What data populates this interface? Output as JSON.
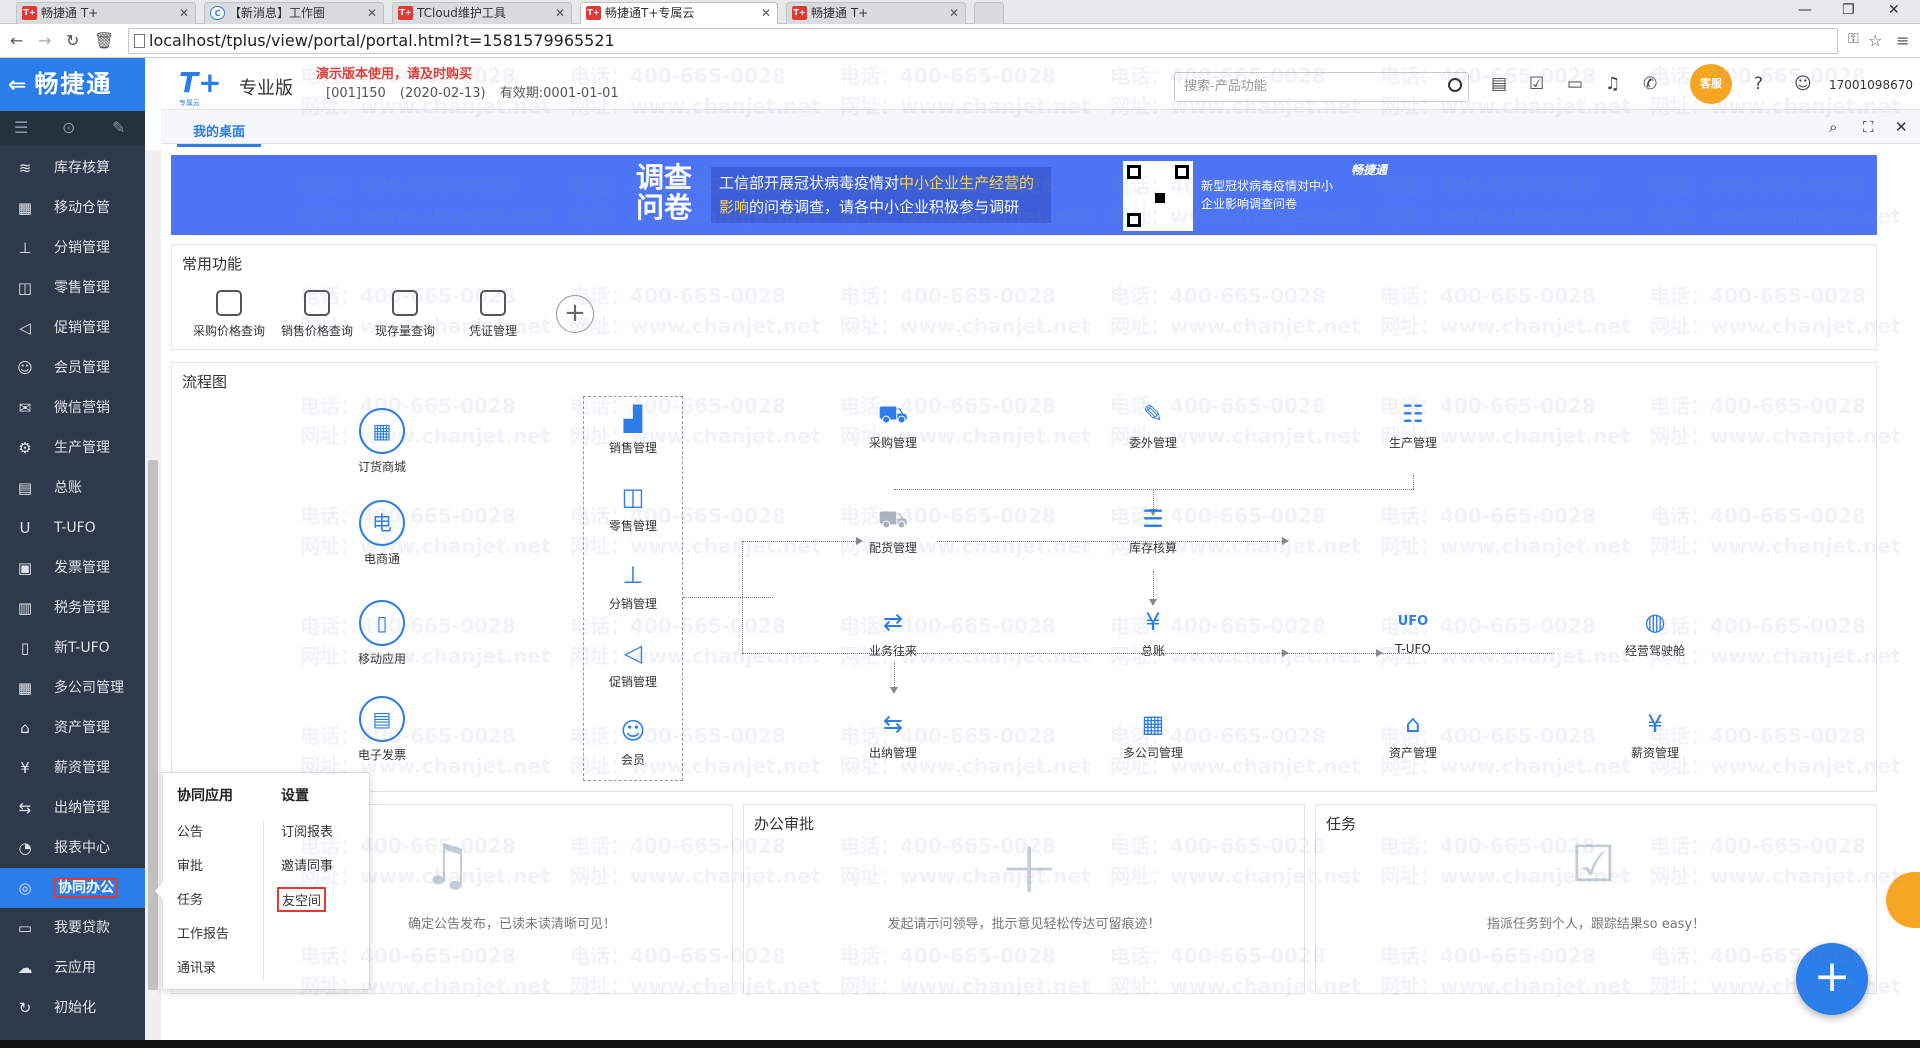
{
  "browser": {
    "tabs": [
      {
        "label": "畅捷通 T+",
        "icon": "T+"
      },
      {
        "label": "【新消息】工作圈",
        "icon": "C"
      },
      {
        "label": "TCloud维护工具",
        "icon": "T+"
      },
      {
        "label": "畅捷通T+专属云",
        "icon": "T+"
      },
      {
        "label": "畅捷通 T+",
        "icon": "T+"
      }
    ],
    "url": "localhost/tplus/view/portal/portal.html?t=1581579965521"
  },
  "sidebar": {
    "logo": "畅捷通",
    "items": [
      {
        "label": "库存核算",
        "icon": "≋"
      },
      {
        "label": "移动仓管",
        "icon": "▦"
      },
      {
        "label": "分销管理",
        "icon": "⊥"
      },
      {
        "label": "零售管理",
        "icon": "◫"
      },
      {
        "label": "促销管理",
        "icon": "◁"
      },
      {
        "label": "会员管理",
        "icon": "☺"
      },
      {
        "label": "微信营销",
        "icon": "✉"
      },
      {
        "label": "生产管理",
        "icon": "⚙"
      },
      {
        "label": "总账",
        "icon": "▤"
      },
      {
        "label": "T-UFO",
        "icon": "U"
      },
      {
        "label": "发票管理",
        "icon": "▣"
      },
      {
        "label": "税务管理",
        "icon": "▥"
      },
      {
        "label": "新T-UFO",
        "icon": "▯"
      },
      {
        "label": "多公司管理",
        "icon": "▦"
      },
      {
        "label": "资产管理",
        "icon": "⌂"
      },
      {
        "label": "薪资管理",
        "icon": "¥"
      },
      {
        "label": "出纳管理",
        "icon": "⇆"
      },
      {
        "label": "报表中心",
        "icon": "◔"
      },
      {
        "label": "协同办公",
        "icon": "◎"
      },
      {
        "label": "我要贷款",
        "icon": "▭"
      },
      {
        "label": "云应用",
        "icon": "☁"
      },
      {
        "label": "初始化",
        "icon": "↻"
      }
    ]
  },
  "header": {
    "product_logo": "T+",
    "product_sub": "专属云",
    "edition": "专业版",
    "demo_notice": "演示版本使用，请及时购买",
    "account": "[001]150",
    "date": "(2020-02-13)",
    "validity": "有效期:0001-01-01",
    "search_placeholder": "搜索-产品功能",
    "avatar_label": "客服",
    "phone": "17001098670"
  },
  "workspace": {
    "tab": "我的桌面"
  },
  "banner": {
    "title": "调查问卷",
    "text_before": "工信部开展冠状病毒疫情对",
    "text_highlight": "中小企业生产经营的",
    "text_highlight2": "影响",
    "text_after": "的问卷调查，请各中小企业积极参与调研",
    "side_text": "新型冠状病毒疫情对中小企业影响调查问卷",
    "brand": "畅捷通"
  },
  "quick": {
    "title": "常用功能",
    "items": [
      "采购价格查询",
      "销售价格查询",
      "现存量查询",
      "凭证管理"
    ],
    "add": "+"
  },
  "flow": {
    "title": "流程图",
    "left": [
      "订货商城",
      "电商通",
      "移动应用",
      "电子发票"
    ],
    "group": [
      "销售管理",
      "零售管理",
      "分销管理",
      "促销管理",
      "会员"
    ],
    "top": [
      "采购管理",
      "委外管理",
      "生产管理"
    ],
    "middle": [
      "配货管理",
      "库存核算"
    ],
    "main": [
      "业务往来",
      "总账",
      "T-UFO",
      "经营驾驶舱"
    ],
    "bottom": [
      "出纳管理",
      "多公司管理",
      "资产管理",
      "薪资管理"
    ]
  },
  "bottom_panels": {
    "notice": {
      "empty": "确定公告发布，已读未读清晰可见！"
    },
    "approval": {
      "title": "办公审批",
      "empty": "发起请示问领导，批示意见轻松传达可留痕迹！"
    },
    "task": {
      "title": "任务",
      "empty": "指派任务到个人，跟踪结果so easy！"
    }
  },
  "popup": {
    "col1_title": "协同应用",
    "col2_title": "设置",
    "col1": [
      "公告",
      "审批",
      "任务",
      "工作报告",
      "通讯录"
    ],
    "col2": [
      "订阅报表",
      "邀请同事",
      "友空间"
    ]
  },
  "fab": "+",
  "watermark": {
    "phone": "电话：400-665-0028",
    "site": "网址：www.chanjet.net"
  }
}
